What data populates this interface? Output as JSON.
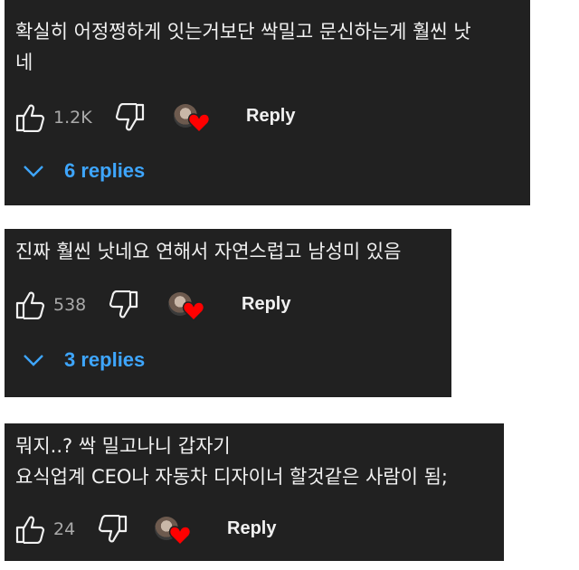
{
  "comments": [
    {
      "text": "확실히 어정쩡하게 잇는거보단 싹밀고 문신하는게 훨씬 낫\n네",
      "likes": "1.2K",
      "reply_label": "Reply",
      "replies_label": "6 replies"
    },
    {
      "text": "진짜 훨씬 낫네요 연해서 자연스럽고 남성미 있음",
      "likes": "538",
      "reply_label": "Reply",
      "replies_label": "3 replies"
    },
    {
      "text": "뭐지..? 싹 밀고나니 갑자기\n요식업계 CEO나 자동차 디자이너 할것같은 사람이 됨;",
      "likes": "24",
      "reply_label": "Reply"
    }
  ],
  "icons": {
    "like": "thumbs-up-icon",
    "dislike": "thumbs-down-icon",
    "creator_heart": "heart-icon",
    "expand": "chevron-down-icon"
  },
  "colors": {
    "card_background": "#212121",
    "text": "#f1f1f1",
    "muted_text": "#aaaaaa",
    "link_blue": "#3ea6ff",
    "heart_red": "#ff0000"
  }
}
